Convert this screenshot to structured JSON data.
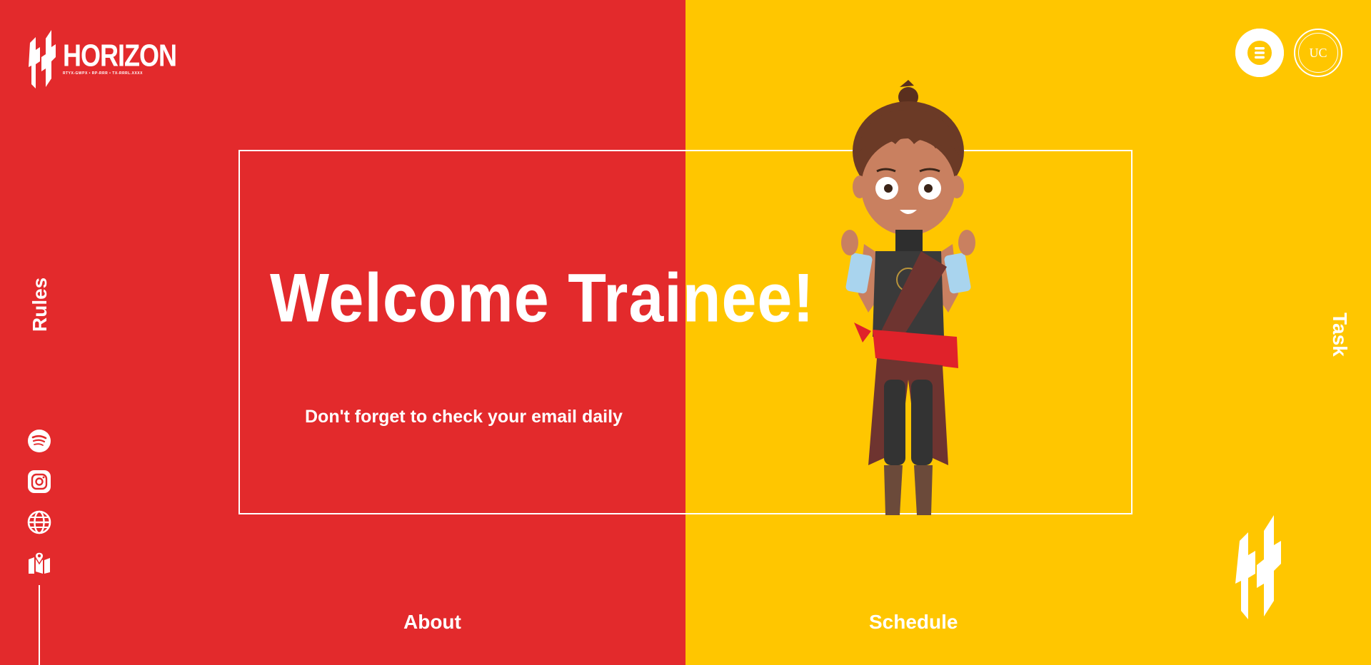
{
  "brand": {
    "name": "HORIZON",
    "tagline": "RTYX-GWPX • RP-RRR • TX-RRRL.XXXX"
  },
  "side_nav": {
    "rules": "Rules",
    "task": "Task"
  },
  "hero": {
    "title": "Welcome Trainee!",
    "subtitle": "Don't forget to check your email daily"
  },
  "bottom_nav": {
    "about": "About",
    "schedule": "Schedule"
  },
  "social_icons": [
    "spotify-icon",
    "instagram-icon",
    "globe-icon",
    "map-icon"
  ],
  "badges": {
    "second_text": "UC"
  },
  "colors": {
    "left_bg": "#E32A2C",
    "right_bg": "#FFC600",
    "text": "#FFFFFF"
  }
}
